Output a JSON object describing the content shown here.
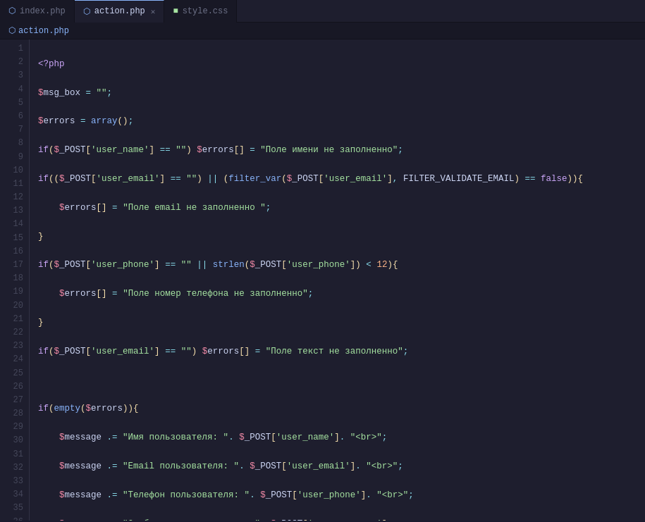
{
  "tabs": [
    {
      "id": "index",
      "label": "index.php",
      "icon": "php",
      "active": false,
      "closeable": false
    },
    {
      "id": "action",
      "label": "action.php",
      "icon": "php",
      "active": true,
      "closeable": true
    },
    {
      "id": "style",
      "label": "style.css",
      "icon": "css",
      "active": false,
      "closeable": false
    }
  ],
  "breadcrumb": "action.php",
  "colors": {
    "accent": "#89b4fa",
    "bg_dark": "#1e1e2e",
    "bg_darker": "#181825",
    "bg_darkest": "#11111b",
    "text": "#cdd6f4",
    "muted": "#6c7086"
  }
}
